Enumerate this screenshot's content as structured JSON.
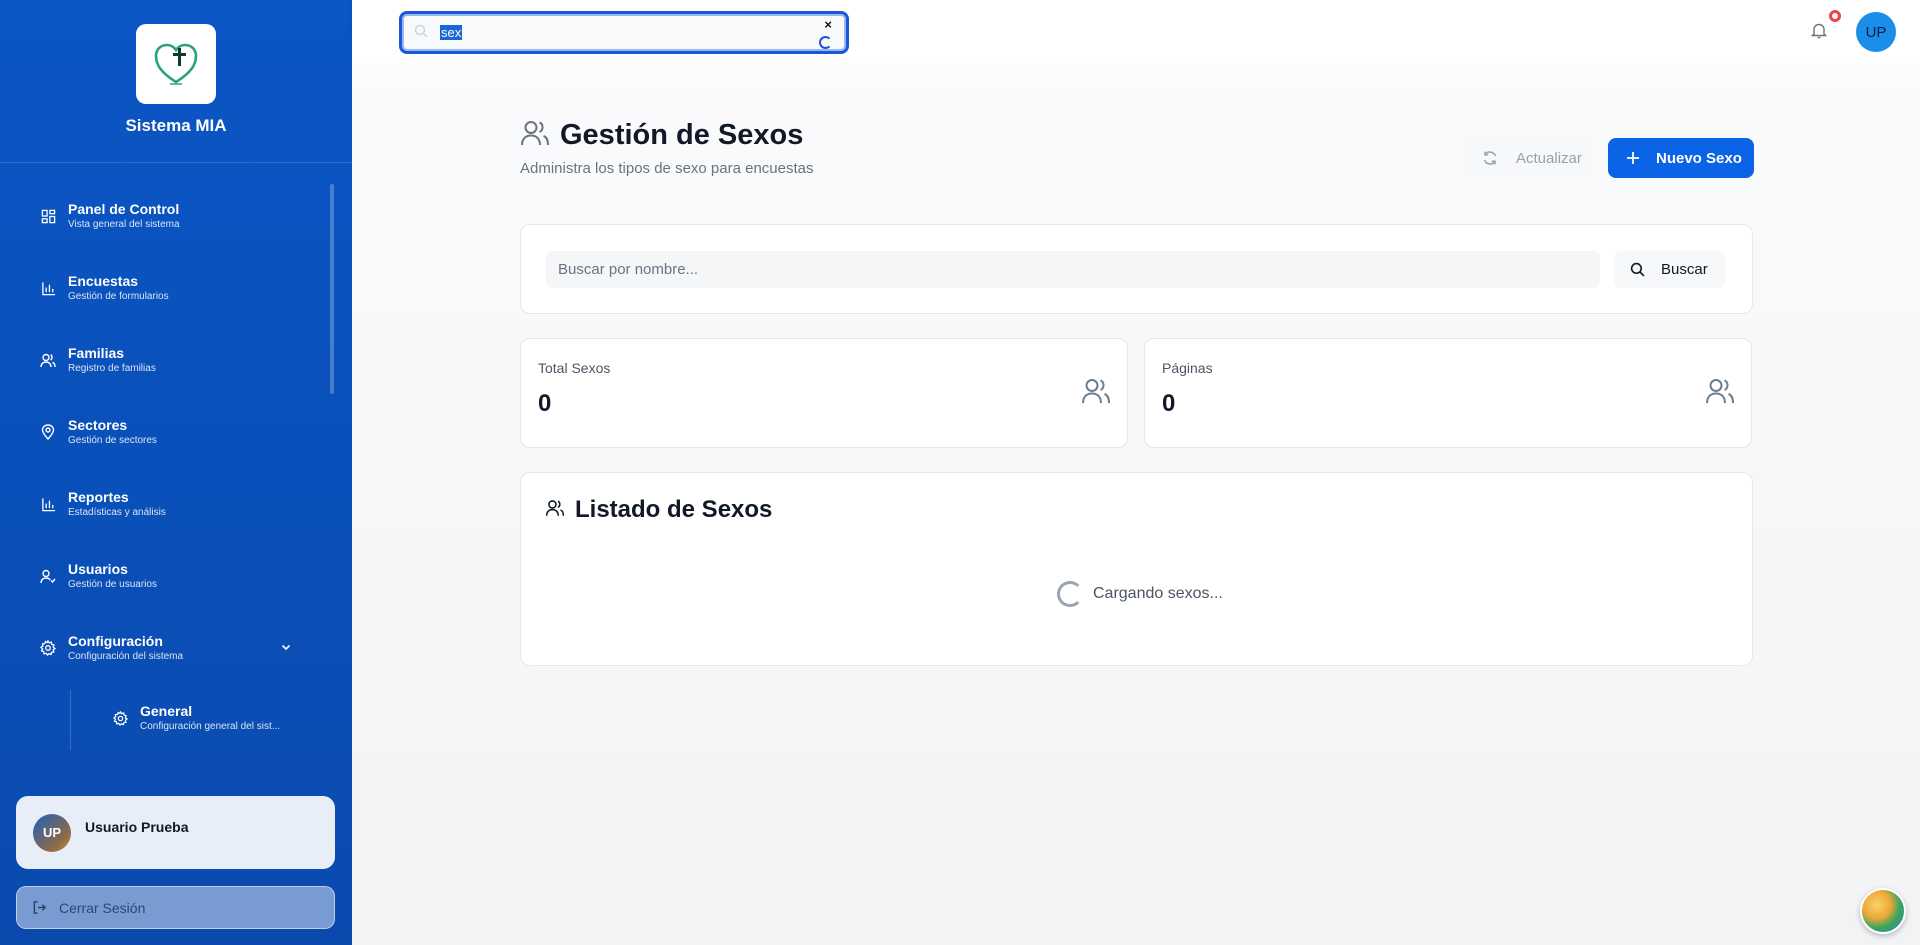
{
  "brand": {
    "title": "Sistema MIA",
    "logo_icon": "heart-cross-icon",
    "accent": "#0b55c4"
  },
  "sidebar": {
    "items": [
      {
        "label": "Panel de Control",
        "sub": "Vista general del sistema",
        "icon": "dashboard-icon"
      },
      {
        "label": "Encuestas",
        "sub": "Gestión de formularios",
        "icon": "bar-chart-icon"
      },
      {
        "label": "Familias",
        "sub": "Registro de familias",
        "icon": "users-icon"
      },
      {
        "label": "Sectores",
        "sub": "Gestión de sectores",
        "icon": "map-pin-icon"
      },
      {
        "label": "Reportes",
        "sub": "Estadísticas y análisis",
        "icon": "bar-chart-icon"
      },
      {
        "label": "Usuarios",
        "sub": "Gestión de usuarios",
        "icon": "user-check-icon"
      },
      {
        "label": "Configuración",
        "sub": "Configuración del sistema",
        "icon": "gear-icon"
      }
    ],
    "subitems": [
      {
        "label": "General",
        "sub": "Configuración general del sist...",
        "icon": "gear-icon"
      }
    ]
  },
  "user": {
    "initials": "UP",
    "name": "Usuario Prueba",
    "logout_label": "Cerrar Sesión"
  },
  "header": {
    "search_value": "sex",
    "clear_symbol": "×",
    "avatar_initials": "UP"
  },
  "page": {
    "title": "Gestión de Sexos",
    "subtitle": "Administra los tipos de sexo para encuestas",
    "refresh_label": "Actualizar",
    "new_label": "Nuevo Sexo"
  },
  "filter": {
    "placeholder": "Buscar por nombre...",
    "search_label": "Buscar"
  },
  "stats": [
    {
      "label": "Total Sexos",
      "value": "0"
    },
    {
      "label": "Páginas",
      "value": "0"
    }
  ],
  "list": {
    "title": "Listado de Sexos",
    "loading_text": "Cargando sexos..."
  }
}
